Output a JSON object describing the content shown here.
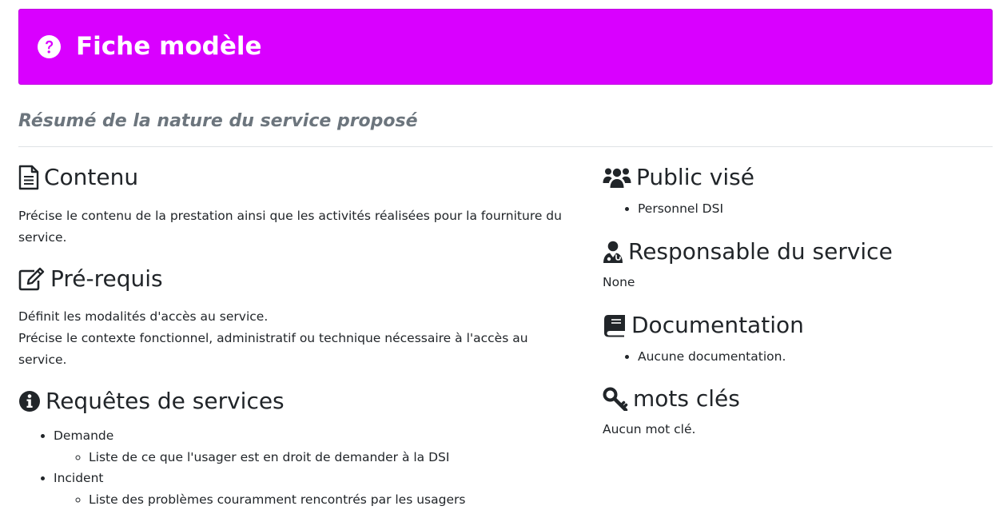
{
  "banner": {
    "title": "Fiche modèle",
    "color": "#d900ff"
  },
  "summary": "Résumé de la nature du service proposé",
  "left": {
    "contenu": {
      "title": "Contenu",
      "text": "Précise le contenu de la prestation ainsi que les activités réalisées pour la fourniture du service."
    },
    "prerequis": {
      "title": "Pré-requis",
      "line1": "Définit les modalités d'accès au service.",
      "line2": "Précise le contexte fonctionnel, administratif ou technique nécessaire à l'accès au service."
    },
    "requetes": {
      "title": "Requêtes de services",
      "items": [
        {
          "label": "Demande",
          "sub": "Liste de ce que l'usager est en droit de demander à la DSI"
        },
        {
          "label": "Incident",
          "sub": "Liste des problèmes couramment rencontrés par les usagers"
        }
      ]
    }
  },
  "right": {
    "public": {
      "title": "Public visé",
      "items": [
        "Personnel DSI"
      ]
    },
    "responsable": {
      "title": "Responsable du service",
      "value": "None"
    },
    "documentation": {
      "title": "Documentation",
      "items": [
        "Aucune documentation."
      ]
    },
    "motscles": {
      "title": "mots clés",
      "value": "Aucun mot clé."
    }
  }
}
